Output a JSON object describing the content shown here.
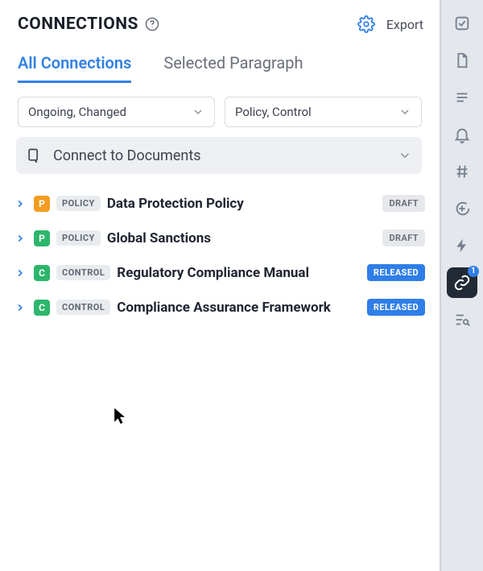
{
  "header": {
    "title": "CONNECTIONS",
    "export_label": "Export"
  },
  "tabs": {
    "all_label": "All Connections",
    "selected_label": "Selected Paragraph",
    "active": "all"
  },
  "filters": {
    "status_label": "Ongoing, Changed",
    "type_label": "Policy, Control"
  },
  "connect_bar": {
    "label": "Connect to Documents"
  },
  "type_pills": {
    "policy": "POLICY",
    "control": "CONTROL"
  },
  "status_labels": {
    "draft": "DRAFT",
    "released": "RELEASED"
  },
  "items": [
    {
      "type_letter": "P",
      "type_color": "orange",
      "type_kind": "policy",
      "title": "Data Protection Policy",
      "status": "draft"
    },
    {
      "type_letter": "P",
      "type_color": "green",
      "type_kind": "policy",
      "title": "Global Sanctions",
      "status": "draft"
    },
    {
      "type_letter": "C",
      "type_color": "ctrlg",
      "type_kind": "control",
      "title": "Regulatory Compliance Manual",
      "status": "released"
    },
    {
      "type_letter": "C",
      "type_color": "ctrlg",
      "type_kind": "control",
      "title": "Compliance Assurance Framework",
      "status": "released"
    }
  ],
  "sidebar": {
    "link_badge": "1",
    "items": [
      {
        "name": "checkbox-icon"
      },
      {
        "name": "document-icon"
      },
      {
        "name": "list-icon"
      },
      {
        "name": "bell-icon"
      },
      {
        "name": "hash-icon"
      },
      {
        "name": "comment-add-icon"
      },
      {
        "name": "bolt-icon"
      },
      {
        "name": "link-icon",
        "active": true
      },
      {
        "name": "search-list-icon"
      }
    ]
  }
}
